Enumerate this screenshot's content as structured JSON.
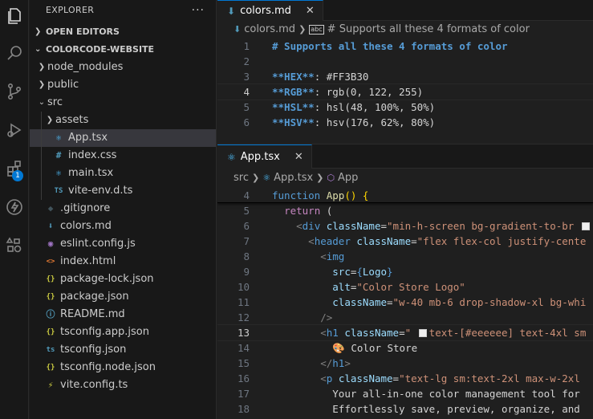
{
  "sidebar": {
    "title": "EXPLORER",
    "more": "···",
    "open_editors": "OPEN EDITORS",
    "project": "COLORCODE-WEBSITE",
    "items": [
      {
        "label": "node_modules",
        "kind": "folder",
        "depth": 1,
        "open": false
      },
      {
        "label": "public",
        "kind": "folder",
        "depth": 1,
        "open": false
      },
      {
        "label": "src",
        "kind": "folder",
        "depth": 1,
        "open": true
      },
      {
        "label": "assets",
        "kind": "folder",
        "depth": 2,
        "open": false
      },
      {
        "label": "App.tsx",
        "kind": "react",
        "depth": 2,
        "selected": true
      },
      {
        "label": "index.css",
        "kind": "css",
        "depth": 2
      },
      {
        "label": "main.tsx",
        "kind": "react",
        "depth": 2
      },
      {
        "label": "vite-env.d.ts",
        "kind": "ts",
        "depth": 2
      },
      {
        "label": ".gitignore",
        "kind": "git",
        "depth": 1
      },
      {
        "label": "colors.md",
        "kind": "md",
        "depth": 1
      },
      {
        "label": "eslint.config.js",
        "kind": "eslint",
        "depth": 1
      },
      {
        "label": "index.html",
        "kind": "html",
        "depth": 1
      },
      {
        "label": "package-lock.json",
        "kind": "json",
        "depth": 1
      },
      {
        "label": "package.json",
        "kind": "json",
        "depth": 1
      },
      {
        "label": "README.md",
        "kind": "info",
        "depth": 1
      },
      {
        "label": "tsconfig.app.json",
        "kind": "json",
        "depth": 1
      },
      {
        "label": "tsconfig.json",
        "kind": "tsconfig",
        "depth": 1
      },
      {
        "label": "tsconfig.node.json",
        "kind": "json",
        "depth": 1
      },
      {
        "label": "vite.config.ts",
        "kind": "vite",
        "depth": 1
      }
    ]
  },
  "activity": {
    "extensions_badge": "1"
  },
  "editor_top": {
    "tab_label": "colors.md",
    "close": "✕",
    "breadcrumb_file": "colors.md",
    "breadcrumb_symbol": "# Supports all these 4 formats of color",
    "lines": [
      {
        "n": "1",
        "tokens": [
          {
            "t": "# Supports all these 4 formats of color",
            "c": "c-heading"
          }
        ]
      },
      {
        "n": "2",
        "tokens": []
      },
      {
        "n": "3",
        "tokens": [
          {
            "t": "**HEX**",
            "c": "c-bold"
          },
          {
            "t": ": #FF3B30",
            "c": "c-text"
          }
        ]
      },
      {
        "n": "4",
        "cur": true,
        "tokens": [
          {
            "t": "**RGB**",
            "c": "c-bold"
          },
          {
            "t": ": rgb(0, 122, 255)",
            "c": "c-text"
          }
        ]
      },
      {
        "n": "5",
        "tokens": [
          {
            "t": "**HSL**",
            "c": "c-bold"
          },
          {
            "t": ": hsl(48, 100%, 50%)",
            "c": "c-text"
          }
        ]
      },
      {
        "n": "6",
        "tokens": [
          {
            "t": "**HSV**",
            "c": "c-bold"
          },
          {
            "t": ": hsv(176, 62%, 80%)",
            "c": "c-text"
          }
        ]
      }
    ]
  },
  "editor_bottom": {
    "tab_label": "App.tsx",
    "close": "✕",
    "breadcrumb_folder": "src",
    "breadcrumb_file": "App.tsx",
    "breadcrumb_symbol": "App",
    "lines": [
      {
        "n": "4",
        "sticky": true,
        "tokens": [
          {
            "t": "function",
            "c": "c-kw"
          },
          {
            "t": " ",
            "c": "c-text"
          },
          {
            "t": "App",
            "c": "c-fn"
          },
          {
            "t": "() ",
            "c": "c-paren"
          },
          {
            "t": "{",
            "c": "c-paren"
          }
        ]
      },
      {
        "n": "5",
        "tokens": [
          {
            "t": "  ",
            "c": "c-text"
          },
          {
            "t": "return",
            "c": "c-kw2"
          },
          {
            "t": " (",
            "c": "c-text"
          }
        ]
      },
      {
        "n": "6",
        "tokens": [
          {
            "t": "    ",
            "c": "c-text"
          },
          {
            "t": "<",
            "c": "c-bracket"
          },
          {
            "t": "div",
            "c": "c-tag"
          },
          {
            "t": " ",
            "c": "c-text"
          },
          {
            "t": "className",
            "c": "c-attr"
          },
          {
            "t": "=",
            "c": "c-text"
          },
          {
            "t": "\"min-h-screen bg-gradient-to-br ",
            "c": "c-str"
          },
          {
            "t": "SWATCH",
            "c": "swatch"
          }
        ]
      },
      {
        "n": "7",
        "tokens": [
          {
            "t": "      ",
            "c": "c-text"
          },
          {
            "t": "<",
            "c": "c-bracket"
          },
          {
            "t": "header",
            "c": "c-tag"
          },
          {
            "t": " ",
            "c": "c-text"
          },
          {
            "t": "className",
            "c": "c-attr"
          },
          {
            "t": "=",
            "c": "c-text"
          },
          {
            "t": "\"flex flex-col justify-cente",
            "c": "c-str"
          }
        ]
      },
      {
        "n": "8",
        "tokens": [
          {
            "t": "        ",
            "c": "c-text"
          },
          {
            "t": "<",
            "c": "c-bracket"
          },
          {
            "t": "img",
            "c": "c-tag"
          }
        ]
      },
      {
        "n": "9",
        "tokens": [
          {
            "t": "          ",
            "c": "c-text"
          },
          {
            "t": "src",
            "c": "c-attr"
          },
          {
            "t": "=",
            "c": "c-text"
          },
          {
            "t": "{",
            "c": "c-brace"
          },
          {
            "t": "Logo",
            "c": "c-var"
          },
          {
            "t": "}",
            "c": "c-brace"
          }
        ]
      },
      {
        "n": "10",
        "tokens": [
          {
            "t": "          ",
            "c": "c-text"
          },
          {
            "t": "alt",
            "c": "c-attr"
          },
          {
            "t": "=",
            "c": "c-text"
          },
          {
            "t": "\"Color Store Logo\"",
            "c": "c-str"
          }
        ]
      },
      {
        "n": "11",
        "tokens": [
          {
            "t": "          ",
            "c": "c-text"
          },
          {
            "t": "className",
            "c": "c-attr"
          },
          {
            "t": "=",
            "c": "c-text"
          },
          {
            "t": "\"w-40 mb-6 drop-shadow-xl bg-whi",
            "c": "c-str"
          }
        ]
      },
      {
        "n": "12",
        "tokens": [
          {
            "t": "        ",
            "c": "c-text"
          },
          {
            "t": "/>",
            "c": "c-bracket"
          }
        ]
      },
      {
        "n": "13",
        "cur": true,
        "tokens": [
          {
            "t": "        ",
            "c": "c-text"
          },
          {
            "t": "<",
            "c": "c-bracket"
          },
          {
            "t": "h1",
            "c": "c-tag"
          },
          {
            "t": " ",
            "c": "c-text"
          },
          {
            "t": "className",
            "c": "c-attr"
          },
          {
            "t": "=",
            "c": "c-text"
          },
          {
            "t": "\" ",
            "c": "c-str"
          },
          {
            "t": "SWATCH",
            "c": "swatch"
          },
          {
            "t": "text-[#eeeeee] text-4xl sm",
            "c": "c-str"
          }
        ]
      },
      {
        "n": "14",
        "tokens": [
          {
            "t": "          ",
            "c": "c-text"
          },
          {
            "t": "🎨 Color Store",
            "c": "c-text"
          }
        ]
      },
      {
        "n": "15",
        "tokens": [
          {
            "t": "        ",
            "c": "c-text"
          },
          {
            "t": "</",
            "c": "c-bracket"
          },
          {
            "t": "h1",
            "c": "c-tag"
          },
          {
            "t": ">",
            "c": "c-bracket"
          }
        ]
      },
      {
        "n": "16",
        "tokens": [
          {
            "t": "        ",
            "c": "c-text"
          },
          {
            "t": "<",
            "c": "c-bracket"
          },
          {
            "t": "p",
            "c": "c-tag"
          },
          {
            "t": " ",
            "c": "c-text"
          },
          {
            "t": "className",
            "c": "c-attr"
          },
          {
            "t": "=",
            "c": "c-text"
          },
          {
            "t": "\"text-lg sm:text-2xl max-w-2xl",
            "c": "c-str"
          }
        ]
      },
      {
        "n": "17",
        "tokens": [
          {
            "t": "          ",
            "c": "c-text"
          },
          {
            "t": "Your all-in-one color management tool for",
            "c": "c-text"
          }
        ]
      },
      {
        "n": "18",
        "tokens": [
          {
            "t": "          ",
            "c": "c-text"
          },
          {
            "t": "Effortlessly save, preview, organize, and",
            "c": "c-text"
          }
        ]
      }
    ]
  }
}
